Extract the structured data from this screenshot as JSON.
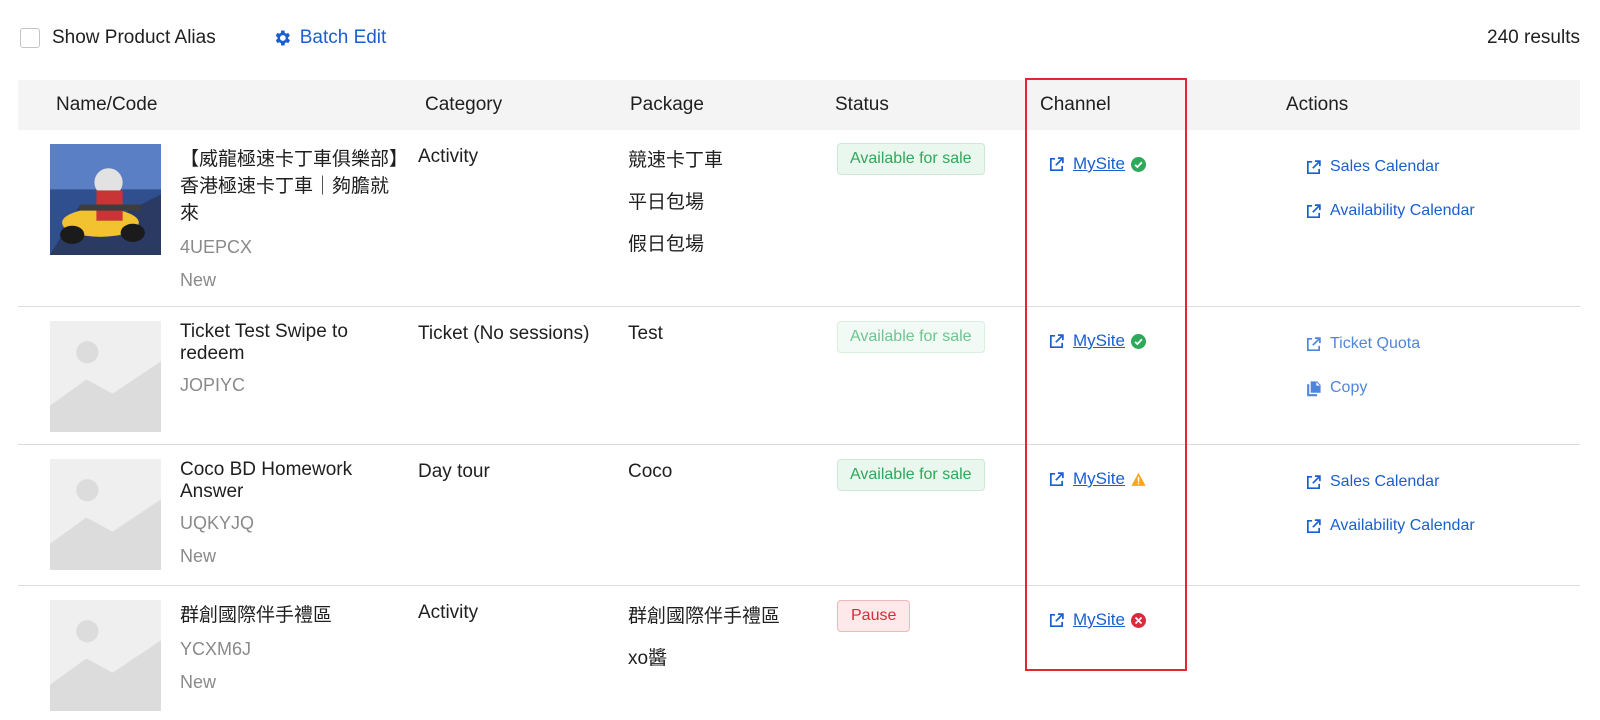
{
  "toolbar": {
    "show_alias_label": "Show Product Alias",
    "batch_edit_label": "Batch Edit",
    "results_label": "240 results"
  },
  "table": {
    "headers": {
      "name": "Name/Code",
      "category": "Category",
      "package": "Package",
      "status": "Status",
      "channel": "Channel",
      "actions": "Actions"
    },
    "rows": [
      {
        "name": "【威龍極速卡丁車俱樂部】香港極速卡丁車｜夠膽就來",
        "code": "4UEPCX",
        "tag": "New",
        "category": "Activity",
        "packages": [
          "競速卡丁車",
          "平日包場",
          "假日包場"
        ],
        "status": "Available for sale",
        "channel": {
          "label": "MySite",
          "state": "ok"
        },
        "actions": [
          "Sales Calendar",
          "Availability Calendar"
        ]
      },
      {
        "name": "Ticket Test Swipe to redeem",
        "code": "JOPIYC",
        "tag": "",
        "category": "Ticket (No sessions)",
        "packages": [
          "Test"
        ],
        "status": "Available for sale",
        "channel": {
          "label": "MySite",
          "state": "ok"
        },
        "actions": [
          "Ticket Quota",
          "Copy"
        ]
      },
      {
        "name": "Coco BD Homework Answer",
        "code": "UQKYJQ",
        "tag": "New",
        "category": "Day tour",
        "packages": [
          "Coco"
        ],
        "status": "Available for sale",
        "channel": {
          "label": "MySite",
          "state": "warning"
        },
        "actions": [
          "Sales Calendar",
          "Availability Calendar"
        ]
      },
      {
        "name": "群創國際伴手禮區",
        "code": "YCXM6J",
        "tag": "New",
        "category": "Activity",
        "packages": [
          "群創國際伴手禮區",
          "xo醬"
        ],
        "status": "Pause",
        "channel": {
          "label": "MySite",
          "state": "error"
        },
        "actions": []
      }
    ]
  },
  "colors": {
    "link": "#1a5fcf",
    "success": "#2ea85a",
    "warning": "#f5a623",
    "error": "#d82b3b",
    "highlight": "#e3262f"
  },
  "icons": {
    "batch_edit": "gear-icon",
    "channel_link": "external-link-icon",
    "ok": "check-circle-icon",
    "warning": "warning-triangle-icon",
    "error": "error-circle-icon",
    "copy": "copy-icon"
  }
}
